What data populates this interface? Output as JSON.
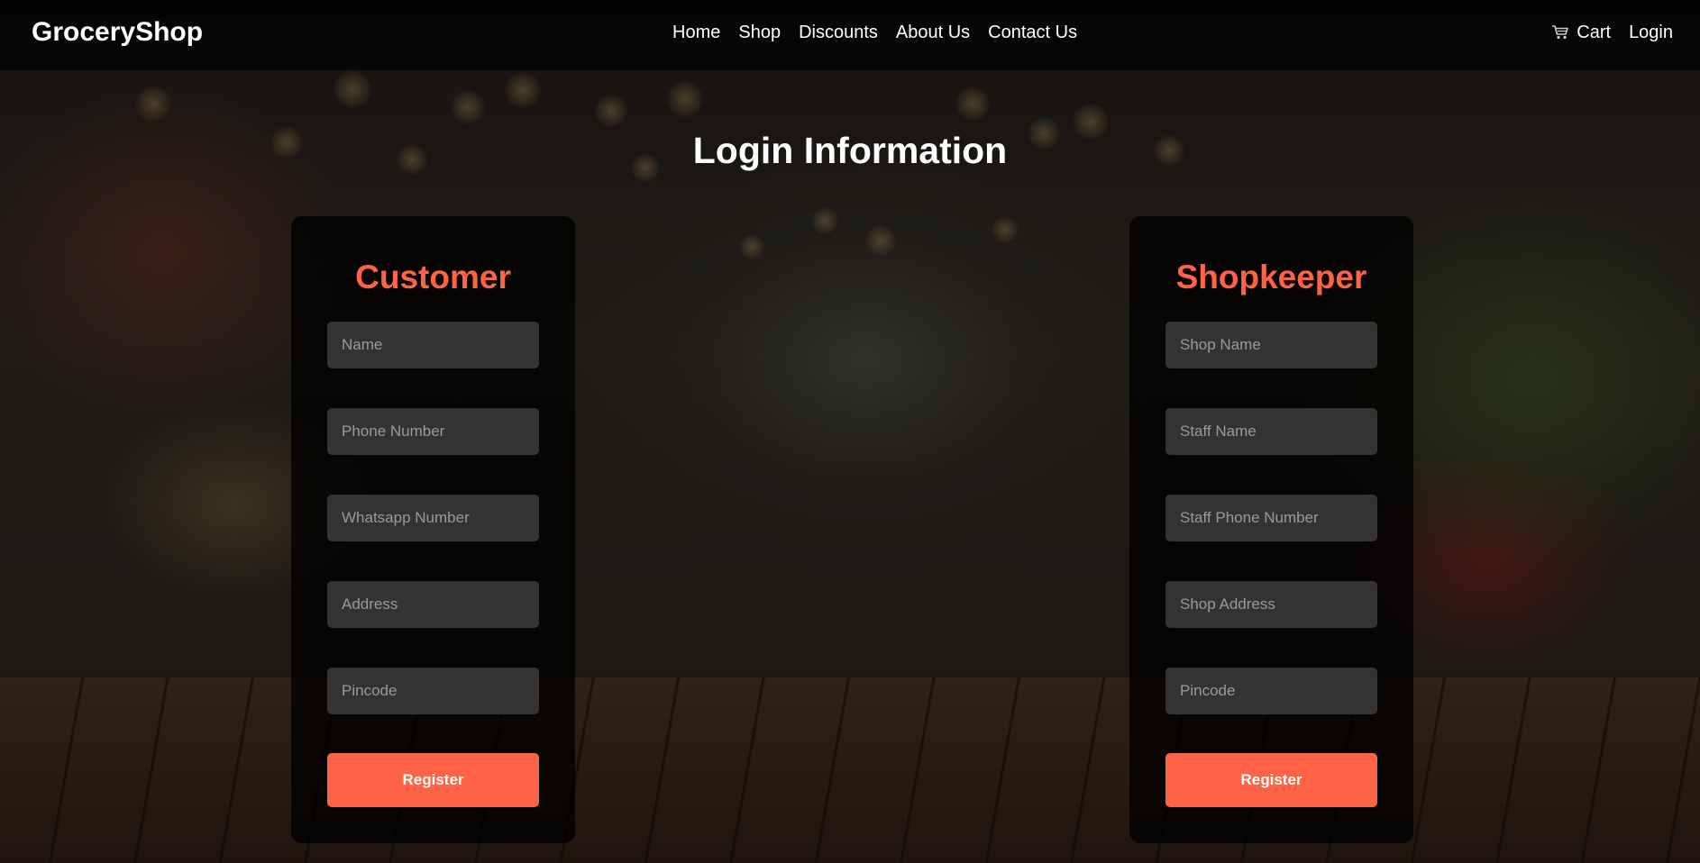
{
  "navbar": {
    "brand": "GroceryShop",
    "links": [
      "Home",
      "Shop",
      "Discounts",
      "About Us",
      "Contact Us"
    ],
    "cart_icon": "shopping-cart-icon",
    "cart_label": "Cart",
    "login_label": "Login"
  },
  "page": {
    "title": "Login Information"
  },
  "customer": {
    "title": "Customer",
    "fields": [
      {
        "placeholder": "Name",
        "value": ""
      },
      {
        "placeholder": "Phone Number",
        "value": ""
      },
      {
        "placeholder": "Whatsapp Number",
        "value": ""
      },
      {
        "placeholder": "Address",
        "value": ""
      },
      {
        "placeholder": "Pincode",
        "value": ""
      }
    ],
    "button_label": "Register"
  },
  "shopkeeper": {
    "title": "Shopkeeper",
    "fields": [
      {
        "placeholder": "Shop Name",
        "value": ""
      },
      {
        "placeholder": "Staff Name",
        "value": ""
      },
      {
        "placeholder": "Staff Phone Number",
        "value": ""
      },
      {
        "placeholder": "Shop Address",
        "value": ""
      },
      {
        "placeholder": "Pincode",
        "value": ""
      }
    ],
    "button_label": "Register"
  },
  "colors": {
    "accent": "#ff6347",
    "card_background": "#000000",
    "field_background": "#333333",
    "text": "#ffffff"
  }
}
